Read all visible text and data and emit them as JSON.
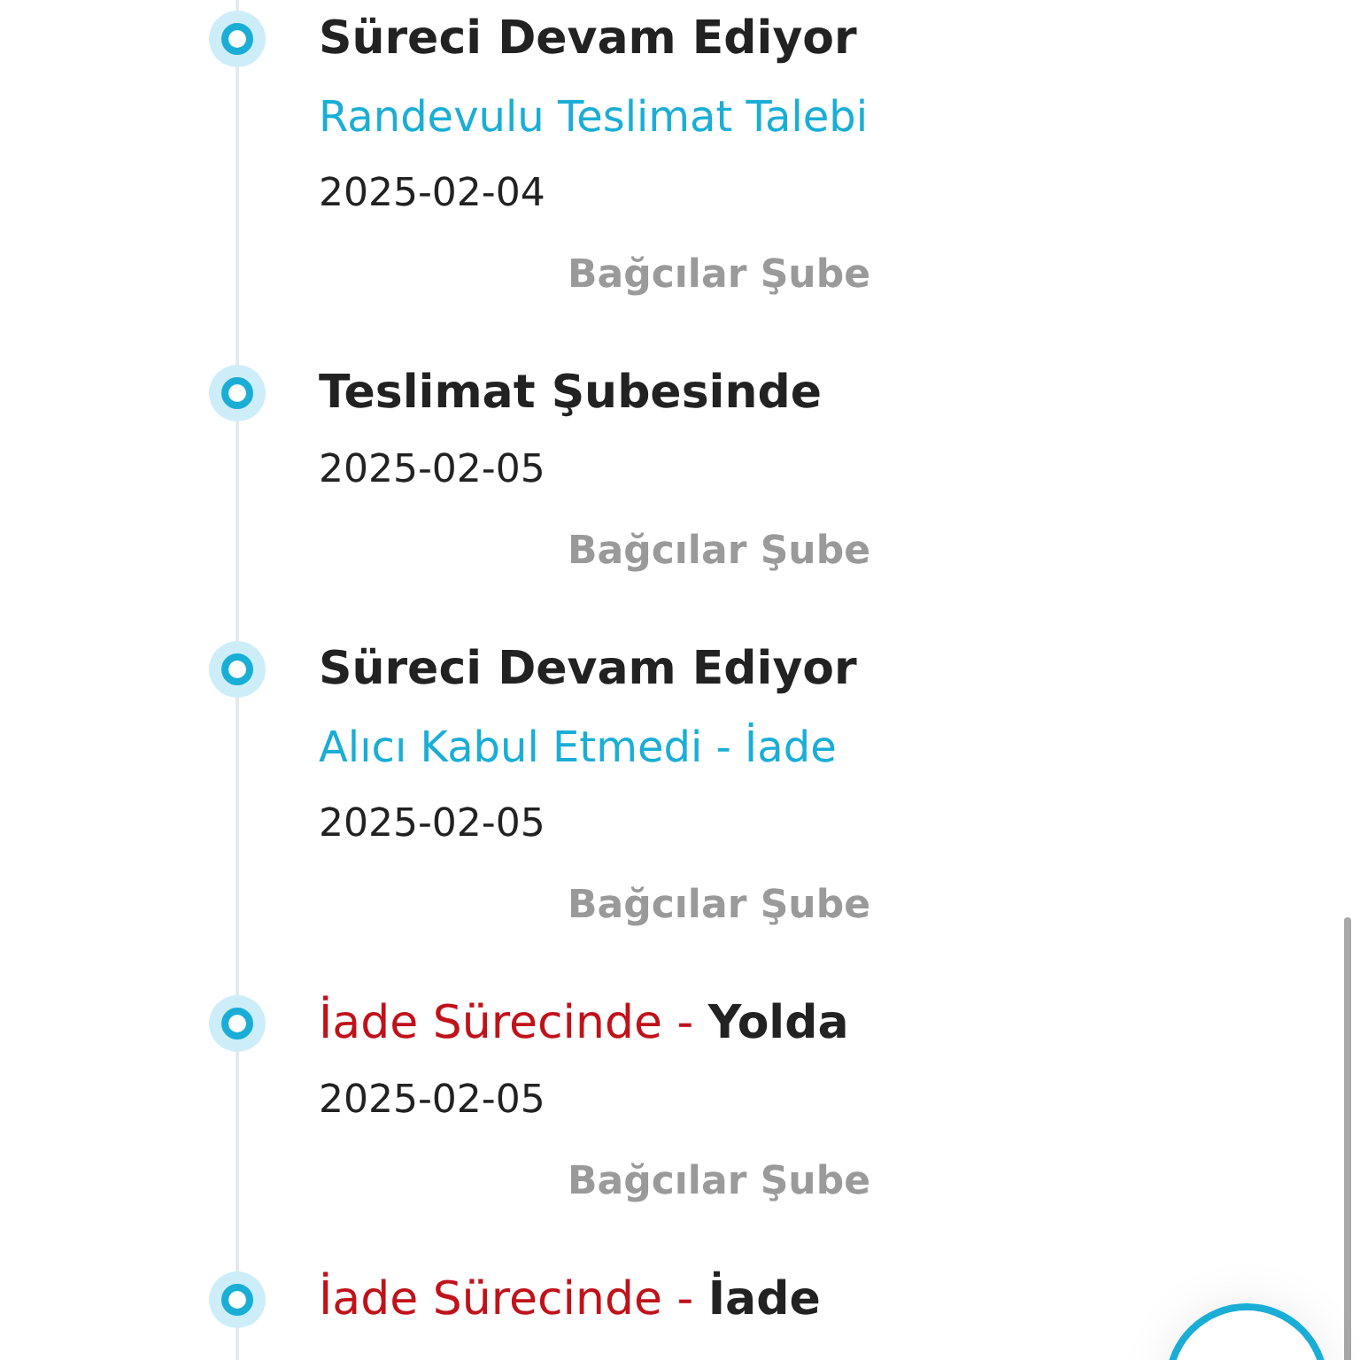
{
  "timeline": [
    {
      "title": "Süreci Devam Ediyor",
      "subtitle": "Randevulu Teslimat Talebi",
      "date": "2025-02-04",
      "branch": "Bağcılar Şube"
    },
    {
      "title": "Teslimat Şubesinde",
      "date": "2025-02-05",
      "branch": "Bağcılar Şube"
    },
    {
      "title": "Süreci Devam Ediyor",
      "subtitle": "Alıcı Kabul Etmedi - İade",
      "date": "2025-02-05",
      "branch": "Bağcılar Şube"
    },
    {
      "status_prefix": "İade Sürecinde -",
      "title": "Yolda",
      "date": "2025-02-05",
      "branch": "Bağcılar Şube"
    },
    {
      "status_prefix": "İade Sürecinde -",
      "title": "İade"
    }
  ]
}
